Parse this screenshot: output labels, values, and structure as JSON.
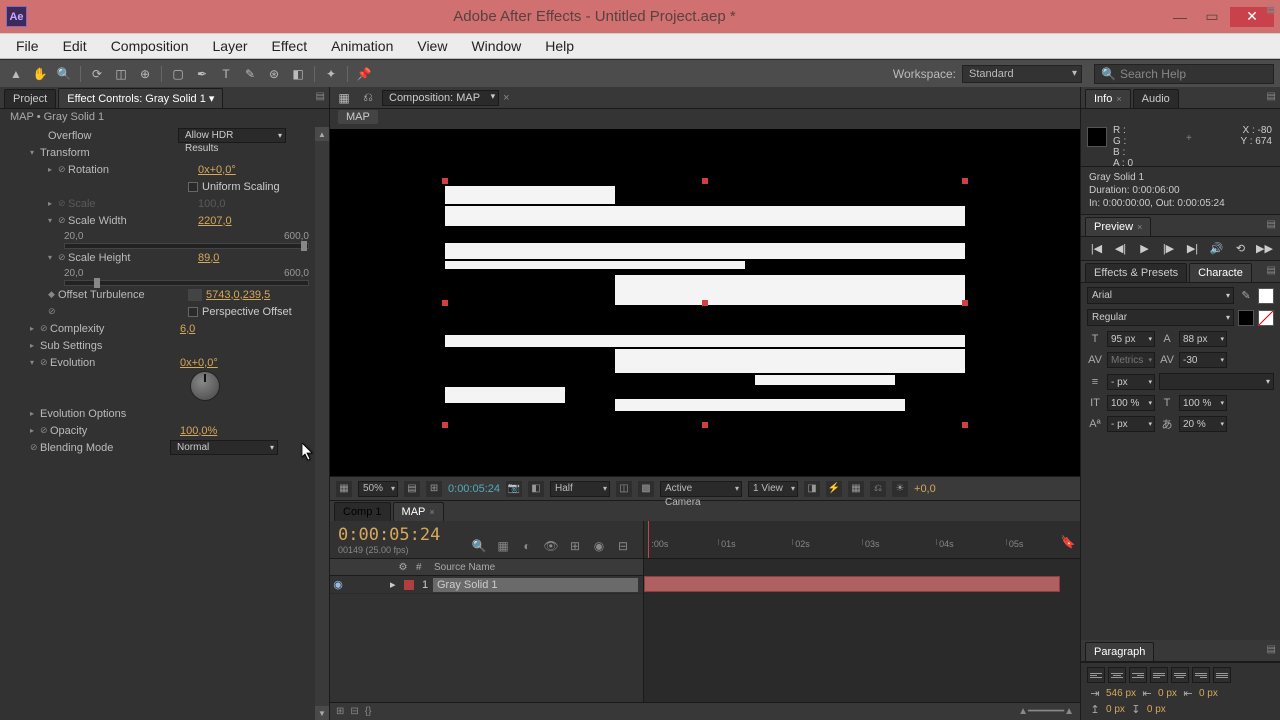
{
  "window": {
    "title": "Adobe After Effects - Untitled Project.aep *",
    "logo": "Ae"
  },
  "menu": [
    "File",
    "Edit",
    "Composition",
    "Layer",
    "Effect",
    "Animation",
    "View",
    "Window",
    "Help"
  ],
  "workspace": {
    "label": "Workspace:",
    "value": "Standard"
  },
  "search": {
    "placeholder": "Search Help"
  },
  "left": {
    "tabs": {
      "project": "Project",
      "effects": "Effect Controls: Gray Solid 1"
    },
    "breadcrumb": "MAP • Gray Solid 1",
    "props": {
      "overflow": {
        "name": "Overflow",
        "value": "Allow HDR Results"
      },
      "transform": "Transform",
      "rotation": {
        "name": "Rotation",
        "value": "0x+0,0°"
      },
      "uniform": "Uniform Scaling",
      "scale": {
        "name": "Scale",
        "value": "100,0"
      },
      "scaleW": {
        "name": "Scale Width",
        "value": "2207,0",
        "min": "20,0",
        "max": "600,0"
      },
      "scaleH": {
        "name": "Scale Height",
        "value": "89,0",
        "min": "20,0",
        "max": "600,0"
      },
      "offset": {
        "name": "Offset Turbulence",
        "value": "5743,0,239,5"
      },
      "perspective": "Perspective Offset",
      "complexity": {
        "name": "Complexity",
        "value": "6,0"
      },
      "sub": "Sub Settings",
      "evolution": {
        "name": "Evolution",
        "value": "0x+0,0°"
      },
      "evoOptions": "Evolution Options",
      "opacity": {
        "name": "Opacity",
        "value": "100,0%"
      },
      "blend": {
        "name": "Blending Mode",
        "value": "Normal"
      }
    }
  },
  "comp": {
    "label": "Composition: MAP",
    "crumb": "MAP",
    "footer": {
      "zoom": "50%",
      "time": "0:00:05:24",
      "res": "Half",
      "camera": "Active Camera",
      "views": "1 View",
      "exposure": "+0,0"
    }
  },
  "right": {
    "info": {
      "tab": "Info",
      "audioTab": "Audio",
      "R": "R :",
      "G": "G :",
      "B": "B :",
      "A": "A : 0",
      "X": "X : -80",
      "Y": "Y : 674"
    },
    "layerMeta": {
      "name": "Gray Solid 1",
      "dur": "Duration: 0:00:06:00",
      "inout": "In: 0:00:00:00, Out: 0:00:05:24"
    },
    "previewTab": "Preview",
    "effectsTab": "Effects & Presets",
    "charTab": "Characte",
    "font": "Arial",
    "style": "Regular",
    "size": "95 px",
    "leading": "88 px",
    "kerning": "Metrics",
    "tracking": "-30",
    "dash": "- px",
    "hscale": "100 %",
    "vscale": "100 %",
    "baseline": "- px",
    "tsume": "20 %",
    "paraTab": "Paragraph",
    "indentL": "546 px",
    "indentR": "0 px",
    "indentF": "0 px",
    "spaceBefore": "0 px",
    "spaceAfter": "0 px"
  },
  "timeline": {
    "tabs": {
      "comp1": "Comp 1",
      "map": "MAP"
    },
    "timecode": "0:00:05:24",
    "timesub": "00149 (25.00 fps)",
    "colSource": "Source Name",
    "colHash": "#",
    "ticks": [
      ":00s",
      "01s",
      "02s",
      "03s",
      "04s",
      "05s"
    ],
    "layer1": {
      "index": "1",
      "name": "Gray Solid 1"
    }
  }
}
